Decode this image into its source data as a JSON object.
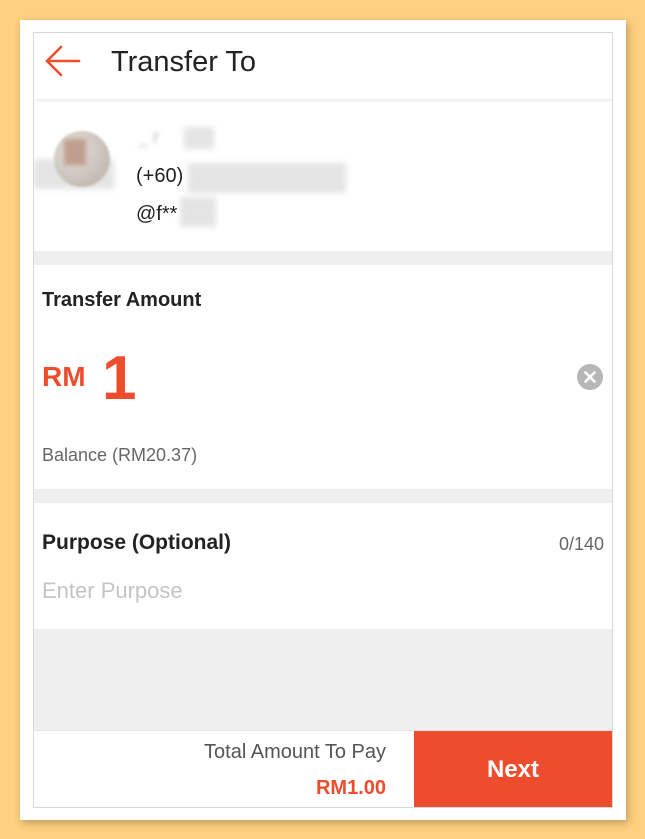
{
  "header": {
    "title": "Transfer To",
    "back_icon": "arrow-left-icon"
  },
  "recipient": {
    "name": "_ r",
    "phone": "(+60)",
    "username": "@f**"
  },
  "amount": {
    "label": "Transfer Amount",
    "currency": "RM",
    "value": "1",
    "balance": "Balance (RM20.37)",
    "clear_icon": "clear-circle-icon"
  },
  "purpose": {
    "label": "Purpose (Optional)",
    "counter": "0/140",
    "value": "",
    "placeholder": "Enter Purpose"
  },
  "footer": {
    "total_label": "Total Amount To Pay",
    "total_value": "RM1.00",
    "next_label": "Next"
  },
  "colors": {
    "accent": "#ee4d2d",
    "page_background": "#ffd080"
  }
}
